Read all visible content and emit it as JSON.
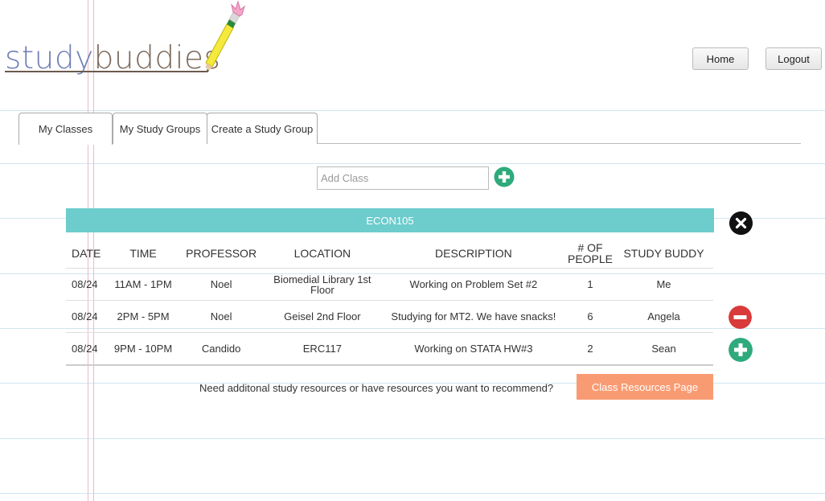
{
  "logo": {
    "part1": "study",
    "part2": "buddies"
  },
  "header": {
    "home_label": "Home",
    "logout_label": "Logout"
  },
  "tabs": [
    {
      "label": "My Classes",
      "active": true
    },
    {
      "label": "My Study Groups",
      "active": false
    },
    {
      "label": "Create a Study Group",
      "active": false
    }
  ],
  "add_class": {
    "placeholder": "Add Class",
    "add_icon": "plus-circle-icon",
    "color": "#2eaa7c"
  },
  "class_panel": {
    "course": "ECON105",
    "header_color": "#6dcccc",
    "close_icon": "close-circle-icon",
    "columns": [
      "DATE",
      "TIME",
      "PROFESSOR",
      "LOCATION",
      "DESCRIPTION",
      "# OF PEOPLE",
      "STUDY BUDDY"
    ],
    "rows": [
      {
        "date": "08/24",
        "time": "11AM - 1PM",
        "professor": "Noel",
        "location": "Biomedial Library 1st Floor",
        "description": "Working on Problem Set #2",
        "people": "1",
        "buddy": "Me",
        "action": "none"
      },
      {
        "date": "08/24",
        "time": "2PM - 5PM",
        "professor": "Noel",
        "location": "Geisel 2nd Floor",
        "description": "Studying for MT2. We have snacks!",
        "people": "6",
        "buddy": "Angela",
        "action": "leave"
      },
      {
        "date": "08/24",
        "time": "9PM - 10PM",
        "professor": "Candido",
        "location": "ERC117",
        "description": "Working on STATA  HW#3",
        "people": "2",
        "buddy": "Sean",
        "action": "join"
      }
    ]
  },
  "resources": {
    "prompt": "Need additonal study resources or have resources you want to recommend?",
    "button_label": "Class Resources Page",
    "button_color": "#f99b72"
  }
}
